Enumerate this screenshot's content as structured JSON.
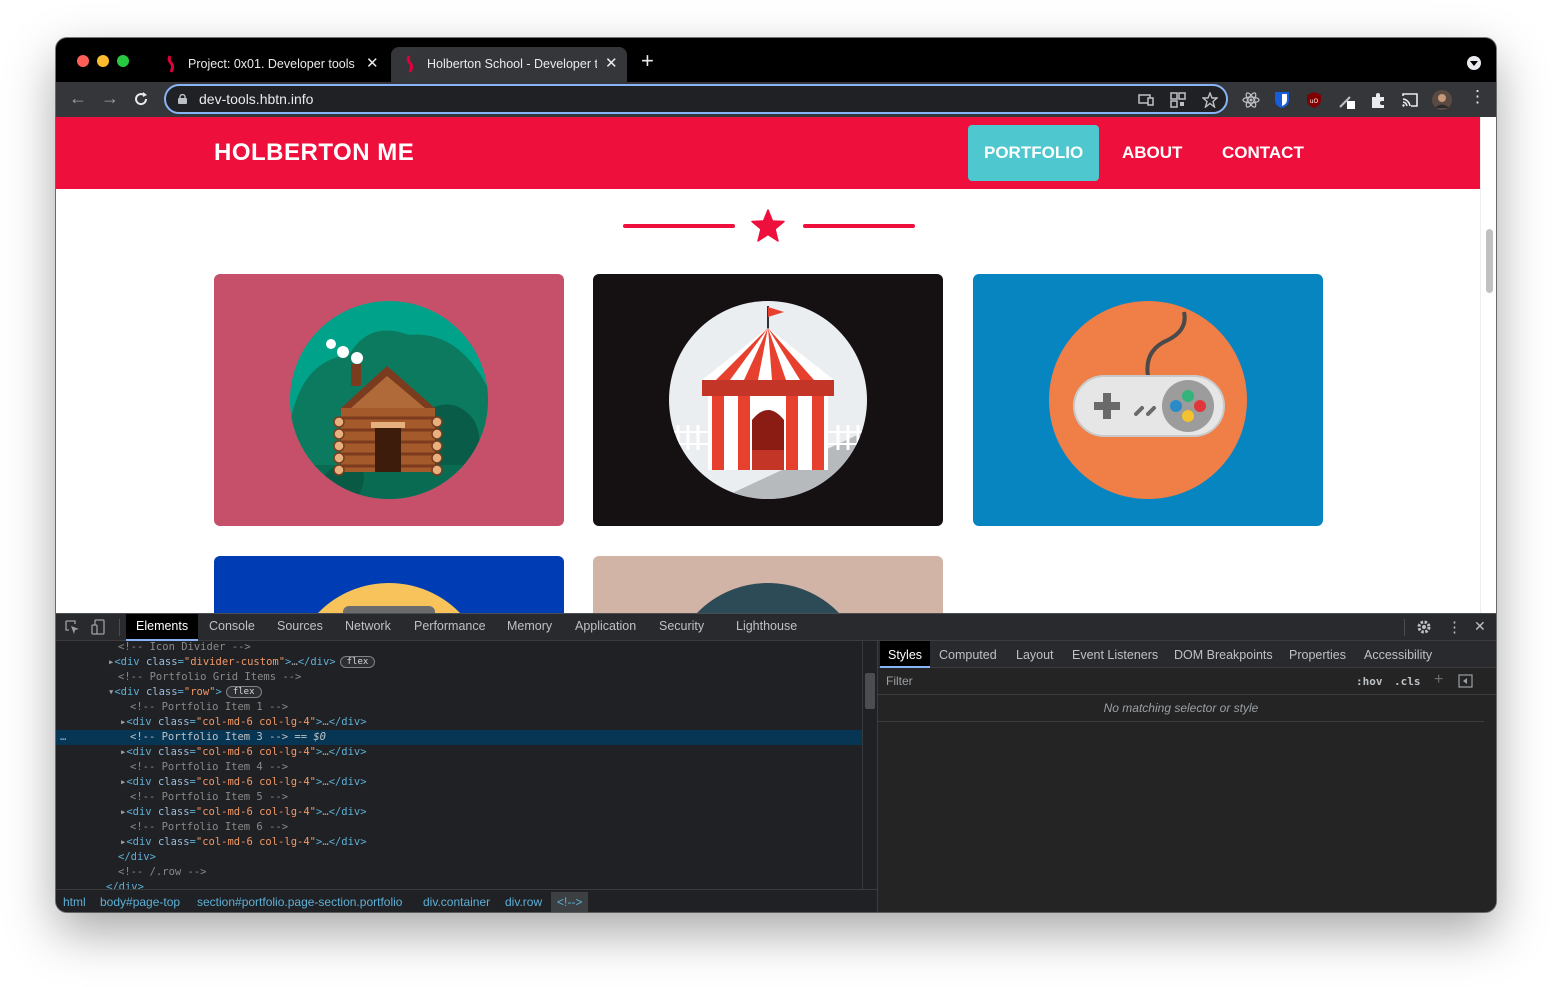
{
  "browser": {
    "tabs": [
      {
        "title": "Project: 0x01. Developer tools |",
        "active": false
      },
      {
        "title": "Holberton School - Developer t",
        "active": true
      }
    ],
    "url": "dev-tools.hbtn.info"
  },
  "site": {
    "brand": "HOLBERTON ME",
    "nav": [
      {
        "label": "PORTFOLIO",
        "active": true
      },
      {
        "label": "ABOUT",
        "active": false
      },
      {
        "label": "CONTACT",
        "active": false
      }
    ],
    "portfolio": [
      {
        "name": "cabin",
        "bg": "#c6506a"
      },
      {
        "name": "circus-tent",
        "bg": "#151112"
      },
      {
        "name": "game-controller",
        "bg": "#0785c1"
      },
      {
        "name": "portfolio-item-4",
        "bg": "#003cb3"
      },
      {
        "name": "portfolio-item-5",
        "bg": "#d2b4a6"
      }
    ],
    "accent": "#ef0f3d",
    "active_nav_color": "#4fc7cf"
  },
  "devtools": {
    "tabs": [
      "Elements",
      "Console",
      "Sources",
      "Network",
      "Performance",
      "Memory",
      "Application",
      "Security",
      "Lighthouse"
    ],
    "active_tab": "Elements",
    "dom_lines": {
      "l0": "<!-- Icon Divider -->",
      "l1_tag": "div",
      "l1_attr": "class",
      "l1_val": "\"divider-custom\"",
      "l1_pill": "flex",
      "l2": "<!-- Portfolio Grid Items -->",
      "l3_attr": "class",
      "l3_val": "\"row\"",
      "l3_pill": "flex",
      "l4": "<!-- Portfolio Item 1 -->",
      "l5_val": "\"col-md-6 col-lg-4\"",
      "l6": "<!-- Portfolio Item 3 -->",
      "l6_suffix": "== $0",
      "l7_val": "\"col-md-6 col-lg-4\"",
      "l8": "<!-- Portfolio Item 4 -->",
      "l9_val": "\"col-md-6 col-lg-4\"",
      "l10": "<!-- Portfolio Item 5 -->",
      "l11_val": "\"col-md-6 col-lg-4\"",
      "l12": "<!-- Portfolio Item 6 -->",
      "l13_val": "\"col-md-6 col-lg-4\"",
      "l14": "</div>",
      "l15": "<!-- /.row -->",
      "l16": "</div>"
    },
    "breadcrumbs": [
      "html",
      "body#page-top",
      "section#portfolio.page-section.portfolio",
      "div.container",
      "div.row",
      "<!-->"
    ],
    "side_tabs": [
      "Styles",
      "Computed",
      "Layout",
      "Event Listeners",
      "DOM Breakpoints",
      "Properties",
      "Accessibility"
    ],
    "active_side_tab": "Styles",
    "filter_placeholder": "Filter",
    "hov": ":hov",
    "cls": ".cls",
    "empty_message": "No matching selector or style"
  }
}
